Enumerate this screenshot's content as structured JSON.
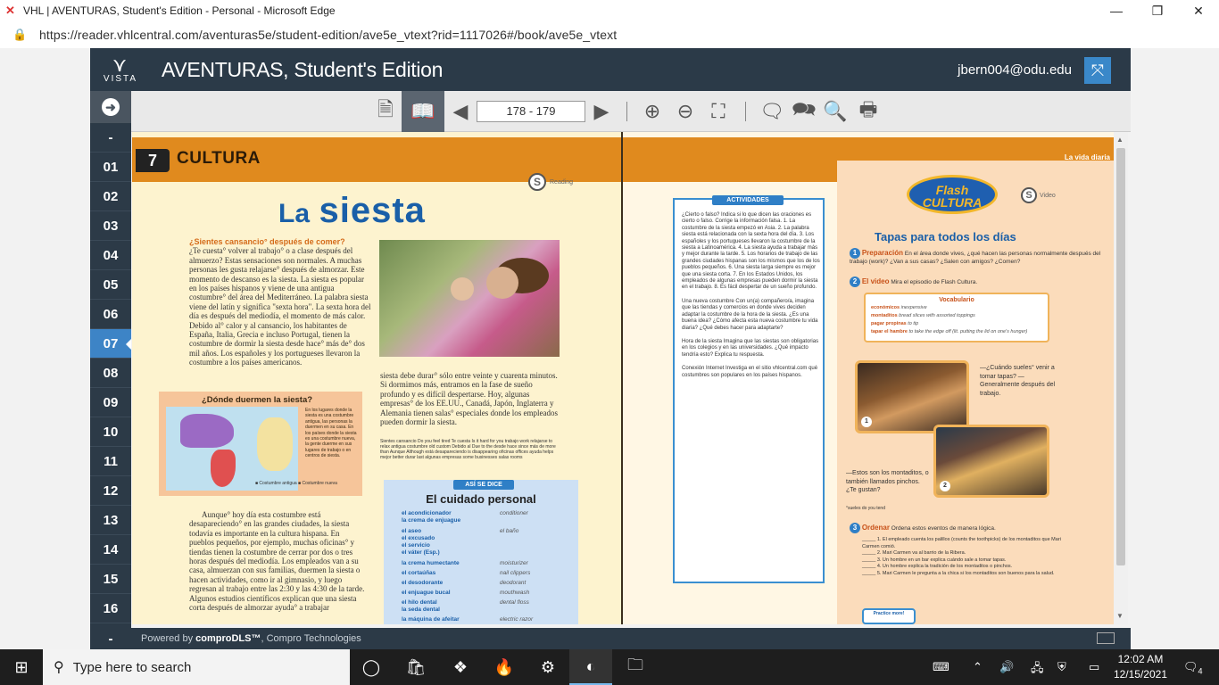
{
  "browser": {
    "title": "VHL | AVENTURAS, Student's Edition - Personal - Microsoft Edge",
    "url": "https://reader.vhlcentral.com/aventuras5e/student-edition/ave5e_vtext?rid=1117026#/book/ave5e_vtext",
    "minimize": "—",
    "restore": "❐",
    "close": "✕"
  },
  "app": {
    "brand": "VISTA",
    "title": "AVENTURAS, Student's Edition",
    "user": "jbern004@odu.edu"
  },
  "toolbar": {
    "page_range": "178 - 179"
  },
  "sidebar": {
    "items": [
      "-",
      "01",
      "02",
      "03",
      "04",
      "05",
      "06",
      "07",
      "08",
      "09",
      "10",
      "11",
      "12",
      "13",
      "14",
      "15",
      "16"
    ],
    "active": "07"
  },
  "left_page": {
    "chapter_num": "7",
    "section": "CULTURA",
    "reading_label": "Reading",
    "title_la": "La",
    "title_siesta": "siesta",
    "intro_question": "¿Sientes cansancio° después de comer?",
    "intro_text": "¿Te cuesta° volver al trabajo° o a clase después del almuerzo? Estas sensaciones son normales. A muchas personas les gusta relajarse° después de almorzar. Este momento de descanso es la siesta. La siesta es popular en los países hispanos y viene de una antigua costumbre° del área del Mediterráneo. La palabra siesta viene del latín y significa \"sexta hora\". La sexta hora del día es después del mediodía, el momento de más calor. Debido al° calor y al cansancio, los habitantes de España, Italia, Grecia e incluso Portugal, tienen la costumbre de dormir la siesta desde hace° más de° dos mil años. Los españoles y los portugueses llevaron la costumbre a los países americanos.",
    "map_title": "¿Dónde duermen la siesta?",
    "map_legend": "En los lugares donde la siesta es una costumbre antigua, las personas la duermen en su casa. En los países donde la siesta es una costumbre nueva, la gente duerme en sus lugares de trabajo o en centros de siesta.",
    "map_key": "■ Costumbre antigua  ■ Costumbre nueva",
    "col2_text": "siesta debe durar° sólo entre veinte y cuarenta minutos. Si dormimos más, entramos en la fase de sueño profundo y es difícil despertarse. Hoy, algunas empresas° de los EE.UU., Canadá, Japón, Inglaterra y Alemania tienen salas° especiales donde los empleados pueden dormir la siesta.",
    "gloss": "Sientes cansancio Do you feel tired  Te cuesta Is it hard for you  trabajo work  relajarse to relax  antigua costumbre old custom  Debido al Due to the  desde hace since  más de more than  Aunque Although  está desapareciendo is disappearing  oficinas offices  ayuda helps  mejor better  durar last  algunas empresas some businesses  salas rooms",
    "vocab_header": "ASÍ SE DICE",
    "vocab_title": "El cuidado personal",
    "vocab": [
      {
        "es": "el acondicionador",
        "en": "conditioner"
      },
      {
        "es": "la crema de enjuague",
        "en": ""
      },
      {
        "es": "el aseo",
        "en": "el baño"
      },
      {
        "es": "el excusado",
        "en": ""
      },
      {
        "es": "el servicio",
        "en": ""
      },
      {
        "es": "el váter (Esp.)",
        "en": ""
      },
      {
        "es": "la crema humectante",
        "en": "moisturizer"
      },
      {
        "es": "el cortaúñas",
        "en": "nail clippers"
      },
      {
        "es": "el desodorante",
        "en": "deodorant"
      },
      {
        "es": "el enjuague bucal",
        "en": "mouthwash"
      },
      {
        "es": "el hilo dental",
        "en": "dental floss"
      },
      {
        "es": "la seda dental",
        "en": ""
      },
      {
        "es": "la máquina de afeitar",
        "en": "electric razor"
      }
    ],
    "col3_text": "Aunque° hoy día esta costumbre está desapareciendo° en las grandes ciudades, la siesta todavía es importante en la cultura hispana. En pueblos pequeños, por ejemplo, muchas oficinas° y tiendas tienen la costumbre de cerrar por dos o tres horas después del mediodía. Los empleados van a su casa, almuerzan con sus familias, duermen la siesta o hacen actividades, como ir al gimnasio, y luego regresan al trabajo entre las 2:30 y las 4:30 de la tarde. Algunos estudios científicos explican que una siesta corta después de almorzar ayuda° a trabajar"
  },
  "right_page": {
    "header_right": "La vida diaria",
    "activities_header": "ACTIVIDADES",
    "activities_text": "¿Cierto o falso? Indica si lo que dicen las oraciones es cierto o falso. Corrige la información falsa. 1. La costumbre de la siesta empezó en Asia. 2. La palabra siesta está relacionada con la sexta hora del día. 3. Los españoles y los portugueses llevaron la costumbre de la siesta a Latinoamérica. 4. La siesta ayuda a trabajar más y mejor durante la tarde. 5. Los horarios de trabajo de las grandes ciudades hispanas son los mismos que los de los pueblos pequeños. 6. Una siesta larga siempre es mejor que una siesta corta. 7. En los Estados Unidos, los empleados de algunas empresas pueden dormir la siesta en el trabajo. 8. Es fácil despertar de un sueño profundo.",
    "activities_text2": "Una nueva costumbre Con un(a) compañero/a, imagina que las tiendas y comercios en donde vives deciden adaptar la costumbre de la hora de la siesta. ¿Es una buena idea? ¿Cómo afecta esta nueva costumbre tu vida diaria? ¿Qué debes hacer para adaptarte?",
    "activities_text3": "Hora de la siesta Imagina que las siestas son obligatorias en los colegios y en las universidades. ¿Qué impacto tendría esto? Explica tu respuesta.",
    "activities_text4": "Conexión Internet Investiga en el sitio vhlcentral.com qué costumbres son populares en los países hispanos.",
    "flash": "Flash CULTURA",
    "video_label": "Video",
    "tapas_title": "Tapas para todos los días",
    "prep_label": "Preparación",
    "prep_text": "En el área donde vives, ¿qué hacen las personas normalmente después del trabajo (work)? ¿Van a sus casas? ¿Salen con amigos? ¿Comen?",
    "video_step_label": "El video",
    "video_step_text": "Mira el episodio de Flash Cultura.",
    "vocab_title": "Vocabulario",
    "vocab": [
      {
        "es": "económicos",
        "en": "inexpensive"
      },
      {
        "es": "montaditos",
        "en": "bread slices with assorted toppings"
      },
      {
        "es": "pagar propinas",
        "en": "to tip"
      },
      {
        "es": "tapar el hambre",
        "en": "to take the edge off (lit. putting the lid on one's hunger)"
      }
    ],
    "quote1": "—¿Cuándo sueles° venir a tomar tapas? —Generalmente después del trabajo.",
    "quote2": "—Estos son los montaditos, o también llamados pinchos. ¿Te gustan?",
    "sueles_gloss": "°sueles do you tend",
    "order_label": "Ordenar",
    "order_text": "Ordena estos eventos de manera lógica.",
    "order_items": [
      "_____ 1. El empleado cuenta los palillos (counts the toothpicks) de los montaditos que Mari Carmen comió.",
      "_____ 2. Mari Carmen va al barrio de la Ribera.",
      "_____ 3. Un hombre en un bar explica cuándo sale a tomar tapas.",
      "_____ 4. Un hombre explica la tradición de los montaditos o pinchos.",
      "_____ 5. Mari Carmen le pregunta a la chica si los montaditos son buenos para la salud."
    ],
    "practice_label": "Practice more!"
  },
  "footer": {
    "dash": "-",
    "powered_prefix": "Powered by ",
    "powered_brand": "comproDLS™",
    "powered_suffix": ", Compro Technologies"
  },
  "taskbar": {
    "search_placeholder": "Type here to search",
    "time": "12:02 AM",
    "date": "12/15/2021",
    "notifications": "4"
  }
}
